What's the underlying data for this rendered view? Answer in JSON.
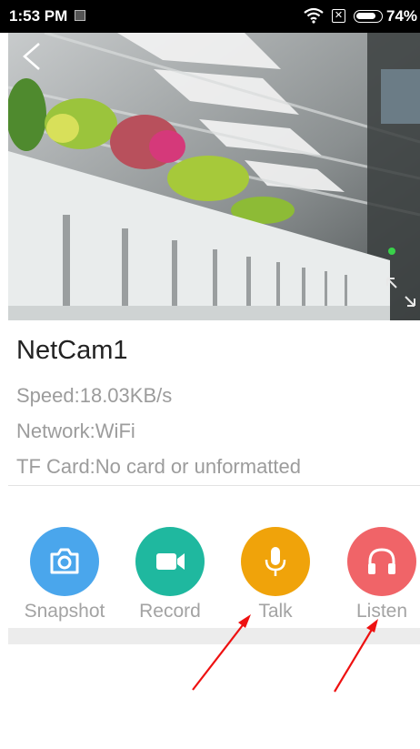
{
  "status_bar": {
    "time": "1:53 PM",
    "battery_text": "74%",
    "sim_symbol": "✕",
    "icons": [
      "app-notification-icon",
      "wifi-icon",
      "sim-icon",
      "battery-icon"
    ]
  },
  "video": {
    "back_icon": "chevron-left-icon",
    "fullscreen_icon": "fullscreen-icon"
  },
  "camera": {
    "name": "NetCam1",
    "speed": "Speed:18.03KB/s",
    "network": "Network:WiFi",
    "tf_card": "TF Card:No card or unformatted"
  },
  "actions": [
    {
      "label": "Snapshot",
      "icon": "camera-icon",
      "color": "#4aa6ec"
    },
    {
      "label": "Record",
      "icon": "video-camera-icon",
      "color": "#1fb89f"
    },
    {
      "label": "Talk",
      "icon": "microphone-icon",
      "color": "#f0a30a"
    },
    {
      "label": "Listen",
      "icon": "headphones-icon",
      "color": "#f06468"
    }
  ],
  "annotation_color": "#ee1111"
}
